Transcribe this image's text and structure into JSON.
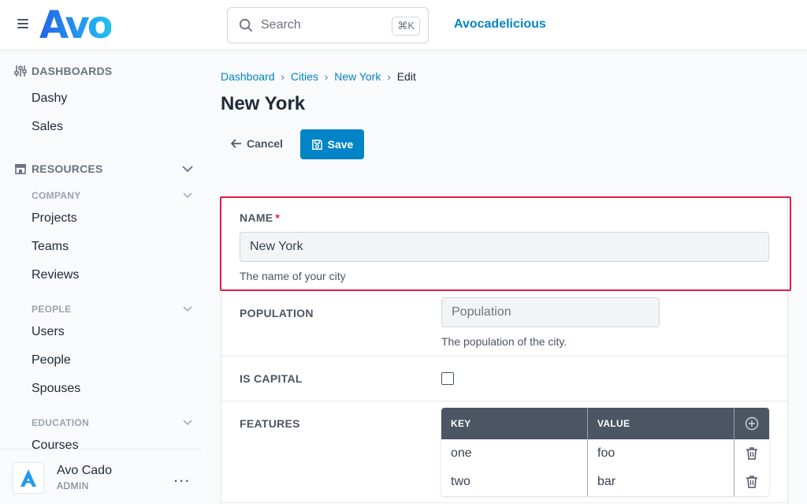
{
  "header": {
    "logo": "Avo",
    "search_placeholder": "Search",
    "search_shortcut": "⌘K",
    "app_name": "Avocadelicious"
  },
  "sidebar": {
    "dashboards_title": "DASHBOARDS",
    "dashboards": [
      "Dashy",
      "Sales"
    ],
    "resources_title": "RESOURCES",
    "groups": [
      {
        "title": "COMPANY",
        "items": [
          "Projects",
          "Teams",
          "Reviews"
        ]
      },
      {
        "title": "PEOPLE",
        "items": [
          "Users",
          "People",
          "Spouses"
        ]
      },
      {
        "title": "EDUCATION",
        "items": [
          "Courses"
        ]
      }
    ]
  },
  "user": {
    "name": "Avo Cado",
    "role": "ADMIN",
    "menu": "..."
  },
  "breadcrumb": [
    "Dashboard",
    "Cities",
    "New York",
    "Edit"
  ],
  "page": {
    "title": "New York",
    "cancel_label": "Cancel",
    "save_label": "Save"
  },
  "form": {
    "name": {
      "label": "NAME",
      "required_mark": "*",
      "value": "New York",
      "help": "The name of your city"
    },
    "population": {
      "label": "POPULATION",
      "placeholder": "Population",
      "help": "The population of the city."
    },
    "is_capital": {
      "label": "IS CAPITAL",
      "checked": false
    },
    "features": {
      "label": "FEATURES",
      "key_header": "KEY",
      "value_header": "VALUE",
      "rows": [
        {
          "key": "one",
          "value": "foo"
        },
        {
          "key": "two",
          "value": "bar"
        }
      ]
    }
  },
  "colors": {
    "accent": "#0284c7",
    "highlight": "#e11d48",
    "table_header": "#4b5563"
  }
}
